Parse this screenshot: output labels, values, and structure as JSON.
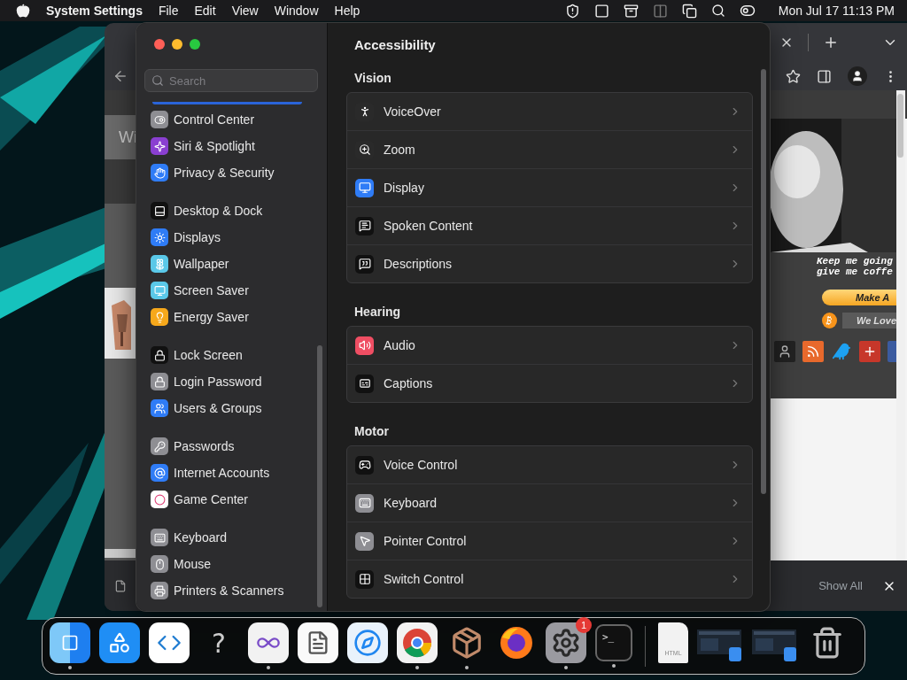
{
  "menu_bar": {
    "app_name": "System Settings",
    "menus": [
      "File",
      "Edit",
      "View",
      "Window",
      "Help"
    ],
    "clock": "Mon Jul 17  11:13 PM"
  },
  "browser": {
    "left_strip": {
      "heading_fragment": "Wi"
    },
    "page": {
      "caption_lines": [
        "Keep me going",
        "give me coffe"
      ],
      "donate_button": "Make A",
      "crypto_button": "We Love"
    },
    "download_bar": {
      "show_all": "Show All"
    }
  },
  "settings": {
    "search": {
      "placeholder": "Search"
    },
    "sidebar": {
      "groups": [
        {
          "items": [
            {
              "label": "Control Center",
              "color": "#8e8e93"
            },
            {
              "label": "Siri & Spotlight",
              "color": "#8a3fd1"
            },
            {
              "label": "Privacy & Security",
              "color": "#2f7cf6"
            }
          ]
        },
        {
          "items": [
            {
              "label": "Desktop & Dock",
              "color": "#111111"
            },
            {
              "label": "Displays",
              "color": "#2f7cf6"
            },
            {
              "label": "Wallpaper",
              "color": "#5ac8e8"
            },
            {
              "label": "Screen Saver",
              "color": "#5ac8e8"
            },
            {
              "label": "Energy Saver",
              "color": "#f7a81b"
            }
          ]
        },
        {
          "items": [
            {
              "label": "Lock Screen",
              "color": "#111111"
            },
            {
              "label": "Login Password",
              "color": "#8e8e93"
            },
            {
              "label": "Users & Groups",
              "color": "#2f7cf6"
            }
          ]
        },
        {
          "items": [
            {
              "label": "Passwords",
              "color": "#8e8e93"
            },
            {
              "label": "Internet Accounts",
              "color": "#2f7cf6"
            },
            {
              "label": "Game Center",
              "color": "#ffffff"
            }
          ]
        },
        {
          "items": [
            {
              "label": "Keyboard",
              "color": "#8e8e93"
            },
            {
              "label": "Mouse",
              "color": "#8e8e93"
            },
            {
              "label": "Printers & Scanners",
              "color": "#8e8e93"
            }
          ]
        }
      ]
    },
    "title": "Accessibility",
    "sections": [
      {
        "title": "Vision",
        "rows": [
          {
            "label": "VoiceOver",
            "color": "#2a2a2a"
          },
          {
            "label": "Zoom",
            "color": "#2a2a2a"
          },
          {
            "label": "Display",
            "color": "#2f7cf6"
          },
          {
            "label": "Spoken Content",
            "color": "#111111"
          },
          {
            "label": "Descriptions",
            "color": "#111111"
          }
        ]
      },
      {
        "title": "Hearing",
        "rows": [
          {
            "label": "Audio",
            "color": "#ef4e63"
          },
          {
            "label": "Captions",
            "color": "#111111"
          }
        ]
      },
      {
        "title": "Motor",
        "rows": [
          {
            "label": "Voice Control",
            "color": "#111111"
          },
          {
            "label": "Keyboard",
            "color": "#8e8e93"
          },
          {
            "label": "Pointer Control",
            "color": "#8e8e93"
          },
          {
            "label": "Switch Control",
            "color": "#111111"
          }
        ]
      }
    ]
  },
  "dock": {
    "items": [
      {
        "kind": "app",
        "running": true
      },
      {
        "kind": "app",
        "running": false
      },
      {
        "kind": "app",
        "running": false
      },
      {
        "kind": "glyph",
        "label": "?",
        "running": false
      },
      {
        "kind": "app",
        "running": true
      },
      {
        "kind": "app",
        "running": false
      },
      {
        "kind": "app",
        "running": false
      },
      {
        "kind": "app",
        "running": true
      },
      {
        "kind": "app",
        "running": true
      },
      {
        "kind": "app",
        "running": false
      },
      {
        "kind": "app",
        "running": true,
        "badge": "1"
      },
      {
        "kind": "terminal",
        "label": ">_",
        "running": true
      },
      {
        "kind": "separator"
      },
      {
        "kind": "document",
        "label": "HTML"
      },
      {
        "kind": "window"
      },
      {
        "kind": "window"
      },
      {
        "kind": "trash"
      }
    ]
  }
}
